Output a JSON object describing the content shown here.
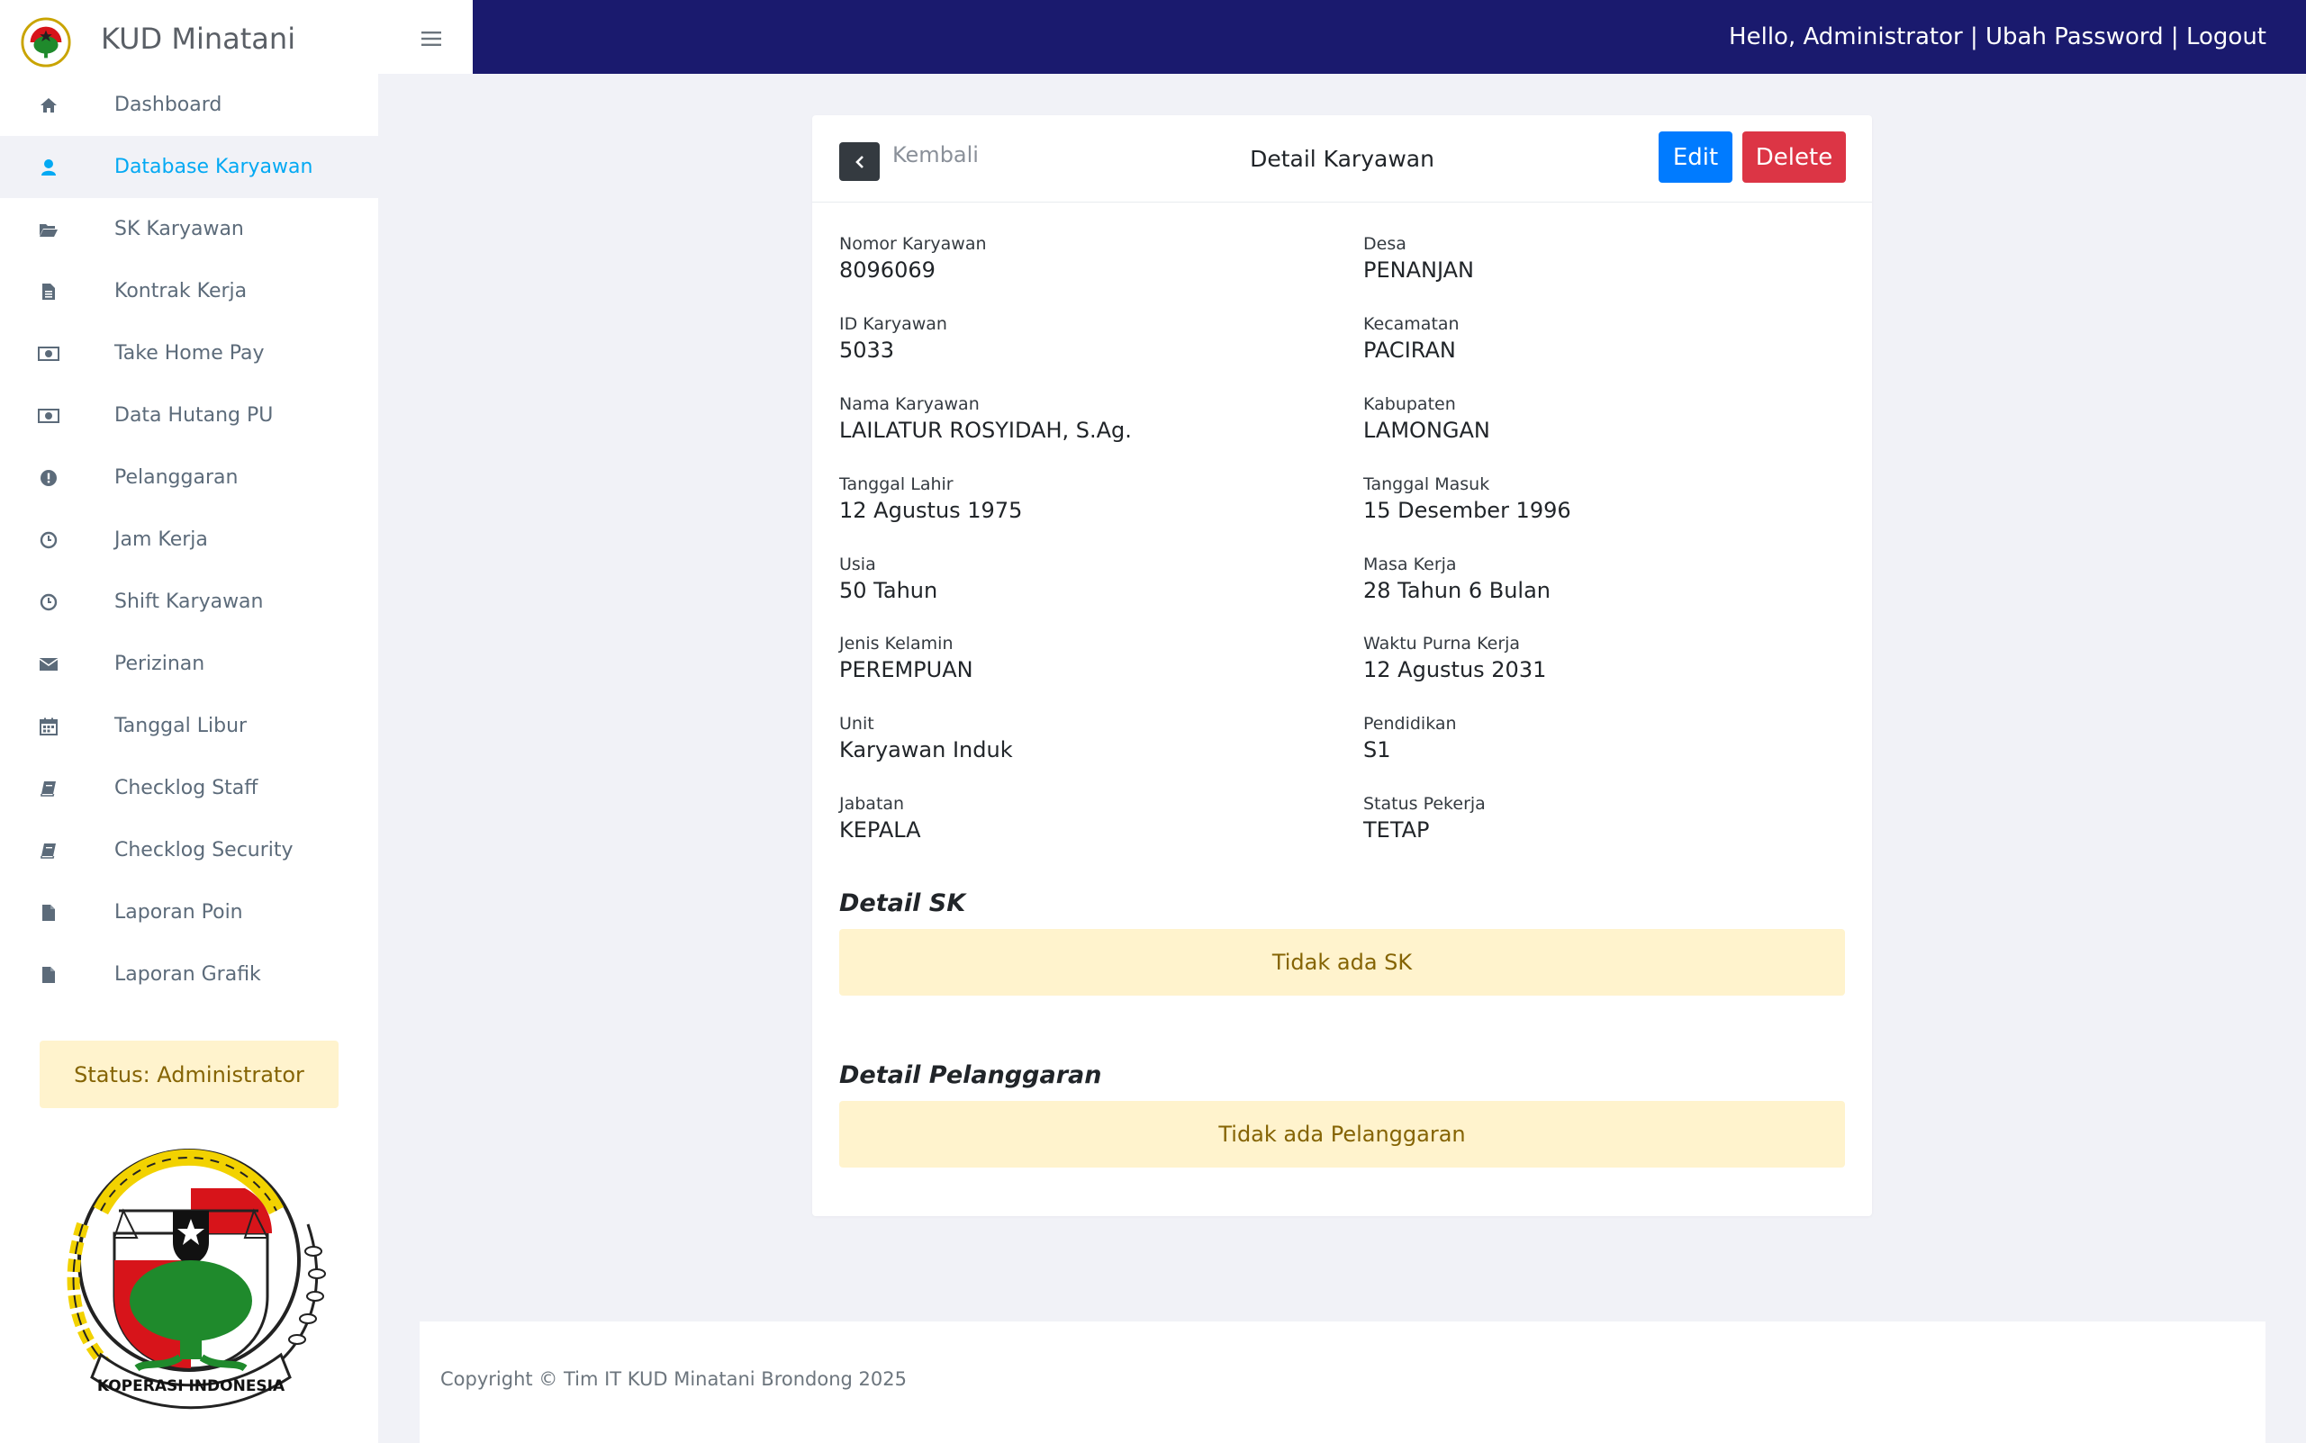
{
  "app": {
    "brand_name": "KUD Minatani"
  },
  "topbar": {
    "greeting": "Hello, Administrator",
    "separator": " | ",
    "change_password": "Ubah Password",
    "logout": "Logout",
    "background_color": "#1a1a6e"
  },
  "sidebar": {
    "items": [
      {
        "label": "Dashboard",
        "icon": "home-icon"
      },
      {
        "label": "Database Karyawan",
        "icon": "user-icon",
        "active": true
      },
      {
        "label": "SK Karyawan",
        "icon": "folder-open-icon"
      },
      {
        "label": "Kontrak Kerja",
        "icon": "file-text-icon"
      },
      {
        "label": "Take Home Pay",
        "icon": "money-icon"
      },
      {
        "label": "Data Hutang PU",
        "icon": "money-icon"
      },
      {
        "label": "Pelanggaran",
        "icon": "exclamation-icon"
      },
      {
        "label": "Jam Kerja",
        "icon": "clock-icon"
      },
      {
        "label": "Shift Karyawan",
        "icon": "clock-icon"
      },
      {
        "label": "Perizinan",
        "icon": "envelope-icon"
      },
      {
        "label": "Tanggal Libur",
        "icon": "calendar-icon"
      },
      {
        "label": "Checklog Staff",
        "icon": "book-icon"
      },
      {
        "label": "Checklog Security",
        "icon": "book-icon"
      },
      {
        "label": "Laporan Poin",
        "icon": "file-icon"
      },
      {
        "label": "Laporan Grafik",
        "icon": "file-icon"
      }
    ],
    "status": "Status: Administrator",
    "seal_text": "KOPERASI INDONESIA",
    "active_color": "#03a9f3"
  },
  "card": {
    "back_label": "Kembali",
    "title": "Detail Karyawan",
    "edit_label": "Edit",
    "delete_label": "Delete",
    "left_fields": [
      {
        "label": "Nomor Karyawan",
        "value": "8096069"
      },
      {
        "label": "ID Karyawan",
        "value": "5033"
      },
      {
        "label": "Nama Karyawan",
        "value": "LAILATUR ROSYIDAH, S.Ag."
      },
      {
        "label": "Tanggal Lahir",
        "value": "12 Agustus 1975"
      },
      {
        "label": "Usia",
        "value": "50 Tahun"
      },
      {
        "label": "Jenis Kelamin",
        "value": "PEREMPUAN"
      },
      {
        "label": "Unit",
        "value": "Karyawan Induk"
      },
      {
        "label": "Jabatan",
        "value": "KEPALA"
      }
    ],
    "right_fields": [
      {
        "label": "Desa",
        "value": "PENANJAN"
      },
      {
        "label": "Kecamatan",
        "value": "PACIRAN"
      },
      {
        "label": "Kabupaten",
        "value": "LAMONGAN"
      },
      {
        "label": "Tanggal Masuk",
        "value": "15 Desember 1996"
      },
      {
        "label": "Masa Kerja",
        "value": "28 Tahun 6 Bulan"
      },
      {
        "label": "Waktu Purna Kerja",
        "value": "12 Agustus 2031"
      },
      {
        "label": "Pendidikan",
        "value": "S1"
      },
      {
        "label": "Status Pekerja",
        "value": "TETAP"
      }
    ],
    "sk_title": "Detail SK",
    "sk_empty": "Tidak ada SK",
    "violation_title": "Detail Pelanggaran",
    "violation_empty": "Tidak ada Pelanggaran"
  },
  "footer": {
    "copyright": "Copyright © Tim IT KUD Minatani Brondong 2025"
  }
}
